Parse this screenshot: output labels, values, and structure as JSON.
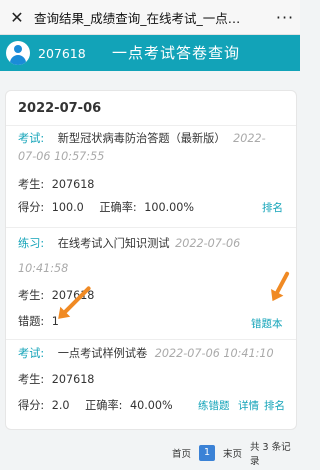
{
  "window": {
    "close_glyph": "✕",
    "title": "查询结果_成绩查询_在线考试_一点…",
    "more_glyph": "···"
  },
  "header": {
    "username": "207618",
    "title": "一点考试答卷查询"
  },
  "record_group": {
    "date": "2022-07-06",
    "records": [
      {
        "tag": "考试:",
        "name": "新型冠状病毒防治答题（最新版）",
        "time_part1": "2022-",
        "time_part2": "07-06 10:57:55",
        "examinee_label": "考生:",
        "examinee": "207618",
        "score_label": "得分:",
        "score": "100.0",
        "accuracy_label": "正确率:",
        "accuracy": "100.00%",
        "actions": [
          "排名"
        ]
      },
      {
        "tag": "练习:",
        "name": "在线考试入门知识测试",
        "time_part1": "2022-07-06",
        "time_part2": "10:41:58",
        "examinee_label": "考生:",
        "examinee": "207618",
        "wrong_label": "错题:",
        "wrong": "1",
        "actions": [
          "错题本"
        ]
      },
      {
        "tag": "考试:",
        "name": "一点考试样例试卷",
        "time": "2022-07-06 10:41:10",
        "examinee_label": "考生:",
        "examinee": "207618",
        "score_label": "得分:",
        "score": "2.0",
        "accuracy_label": "正确率:",
        "accuracy": "40.00%",
        "actions": [
          "练错题",
          "详情",
          "排名"
        ]
      }
    ]
  },
  "pagination": {
    "first": "首页",
    "current": "1",
    "last": "末页",
    "summary": "共 3 条记录"
  },
  "colors": {
    "accent": "#12a3b8",
    "arrow": "#f08a24",
    "page_current": "#3b82d6"
  }
}
